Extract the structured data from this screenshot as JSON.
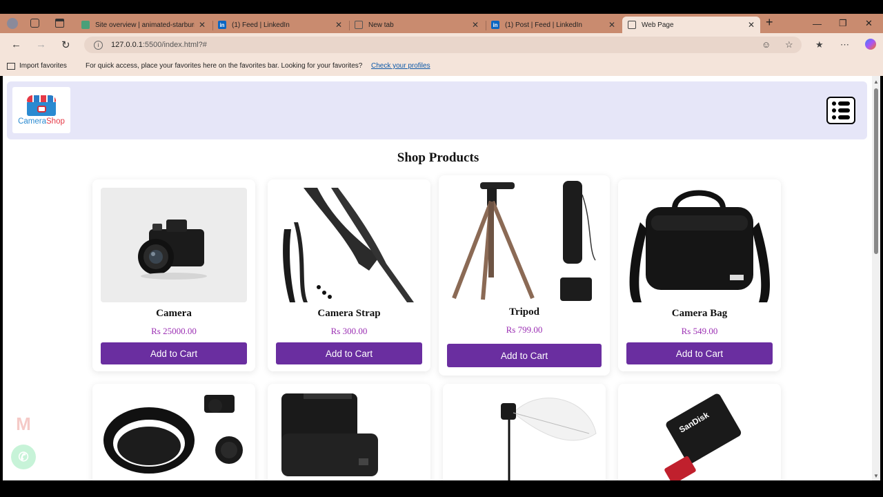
{
  "browser": {
    "tabs": [
      {
        "title": "Site overview | animated-starburst",
        "icon": "site-icon"
      },
      {
        "title": "(1) Feed | LinkedIn",
        "icon": "linkedin-icon"
      },
      {
        "title": "New tab",
        "icon": "newtab-icon"
      },
      {
        "title": "(1) Post | Feed | LinkedIn",
        "icon": "linkedin-icon"
      },
      {
        "title": "Web Page",
        "icon": "document-icon",
        "active": true
      }
    ],
    "new_tab_symbol": "+",
    "close_symbol": "✕",
    "url_host": "127.0.0.1",
    "url_path": ":5500/index.html?#",
    "favbar": {
      "import_label": "Import favorites",
      "message": "For quick access, place your favorites here on the favorites bar. Looking for your favorites?",
      "link": "Check your profiles"
    }
  },
  "page": {
    "logo": {
      "part1": "Camera",
      "part2": "Shop"
    },
    "section_title": "Shop Products",
    "products": [
      {
        "name": "Camera",
        "price": "Rs 25000.00",
        "button": "Add to Cart"
      },
      {
        "name": "Camera Strap",
        "price": "Rs 300.00",
        "button": "Add to Cart"
      },
      {
        "name": "Tripod",
        "price": "Rs 799.00",
        "button": "Add to Cart"
      },
      {
        "name": "Camera Bag",
        "price": "Rs 549.00",
        "button": "Add to Cart"
      }
    ],
    "more_products": [
      "lens-hood",
      "camera-battery",
      "studio-light-umbrella",
      "sandisk-sd-card"
    ],
    "sandisk_label": "SanDisk"
  },
  "colors": {
    "button": "#6a2ea0",
    "price": "#9b2fb3",
    "header_bg": "#e6e6f8",
    "tabstrip": "#c98b6f"
  }
}
